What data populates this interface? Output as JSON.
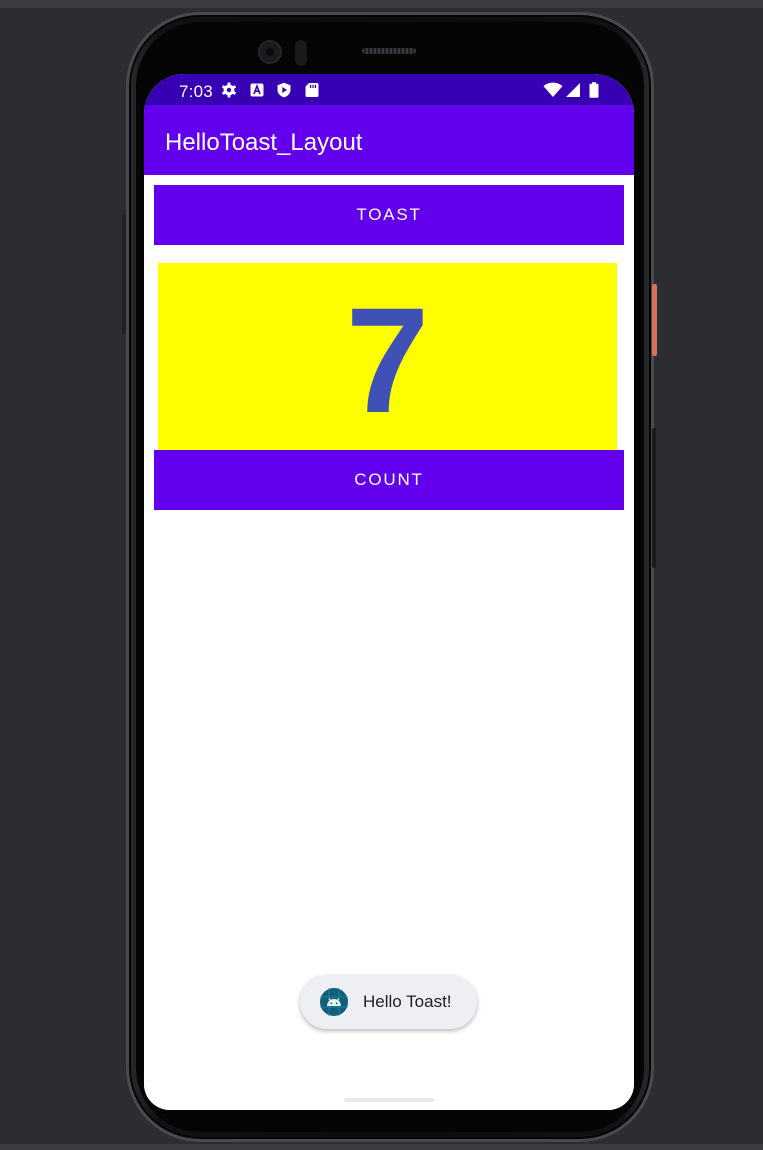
{
  "status_bar": {
    "time": "7:03",
    "icons": [
      "gear-icon",
      "a-icon",
      "shield-play-icon",
      "sd-card-icon",
      "wifi-icon",
      "signal-icon",
      "battery-icon"
    ],
    "background": "#3700b3"
  },
  "app_bar": {
    "title": "HelloToast_Layout",
    "background": "#6200ee"
  },
  "main": {
    "toast_button_label": "TOAST",
    "count_value": "7",
    "count_button_label": "COUNT",
    "count_panel_color": "#ffff00",
    "count_text_color": "#3f51b5"
  },
  "toast_popup": {
    "text": "Hello Toast!",
    "icon": "android-icon"
  },
  "colors": {
    "primary": "#6200ee",
    "primary_dark": "#3700b3"
  }
}
